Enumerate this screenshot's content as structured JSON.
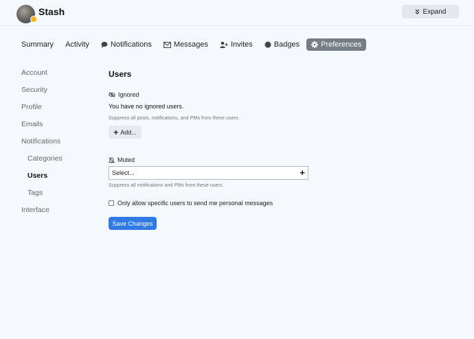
{
  "header": {
    "username": "Stash",
    "expand_label": "Expand"
  },
  "tabs": [
    {
      "label": "Summary",
      "icon": null
    },
    {
      "label": "Activity",
      "icon": null
    },
    {
      "label": "Notifications",
      "icon": "comment-icon"
    },
    {
      "label": "Messages",
      "icon": "envelope-icon"
    },
    {
      "label": "Invites",
      "icon": "user-plus-icon"
    },
    {
      "label": "Badges",
      "icon": "badge-icon"
    },
    {
      "label": "Preferences",
      "icon": "gear-icon",
      "active": true
    }
  ],
  "sidebar": {
    "items": [
      {
        "label": "Account"
      },
      {
        "label": "Security"
      },
      {
        "label": "Profile"
      },
      {
        "label": "Emails"
      },
      {
        "label": "Notifications"
      },
      {
        "label": "Categories",
        "sub": true
      },
      {
        "label": "Users",
        "sub": true,
        "active": true
      },
      {
        "label": "Tags",
        "sub": true
      },
      {
        "label": "Interface"
      }
    ]
  },
  "main": {
    "title": "Users",
    "ignored": {
      "label": "Ignored",
      "empty_text": "You have no ignored users.",
      "help": "Suppress all posts, notifications, and PMs from these users.",
      "add_label": "Add..."
    },
    "muted": {
      "label": "Muted",
      "select_placeholder": "Select...",
      "help": "Suppress all notifications and PMs from these users."
    },
    "allow_pm_label": "Only allow specific users to send me personal messages",
    "save_label": "Save Changes"
  },
  "colors": {
    "accent": "#2f7ae5",
    "active_tab": "#767d85",
    "background": "#f5f8fc"
  }
}
